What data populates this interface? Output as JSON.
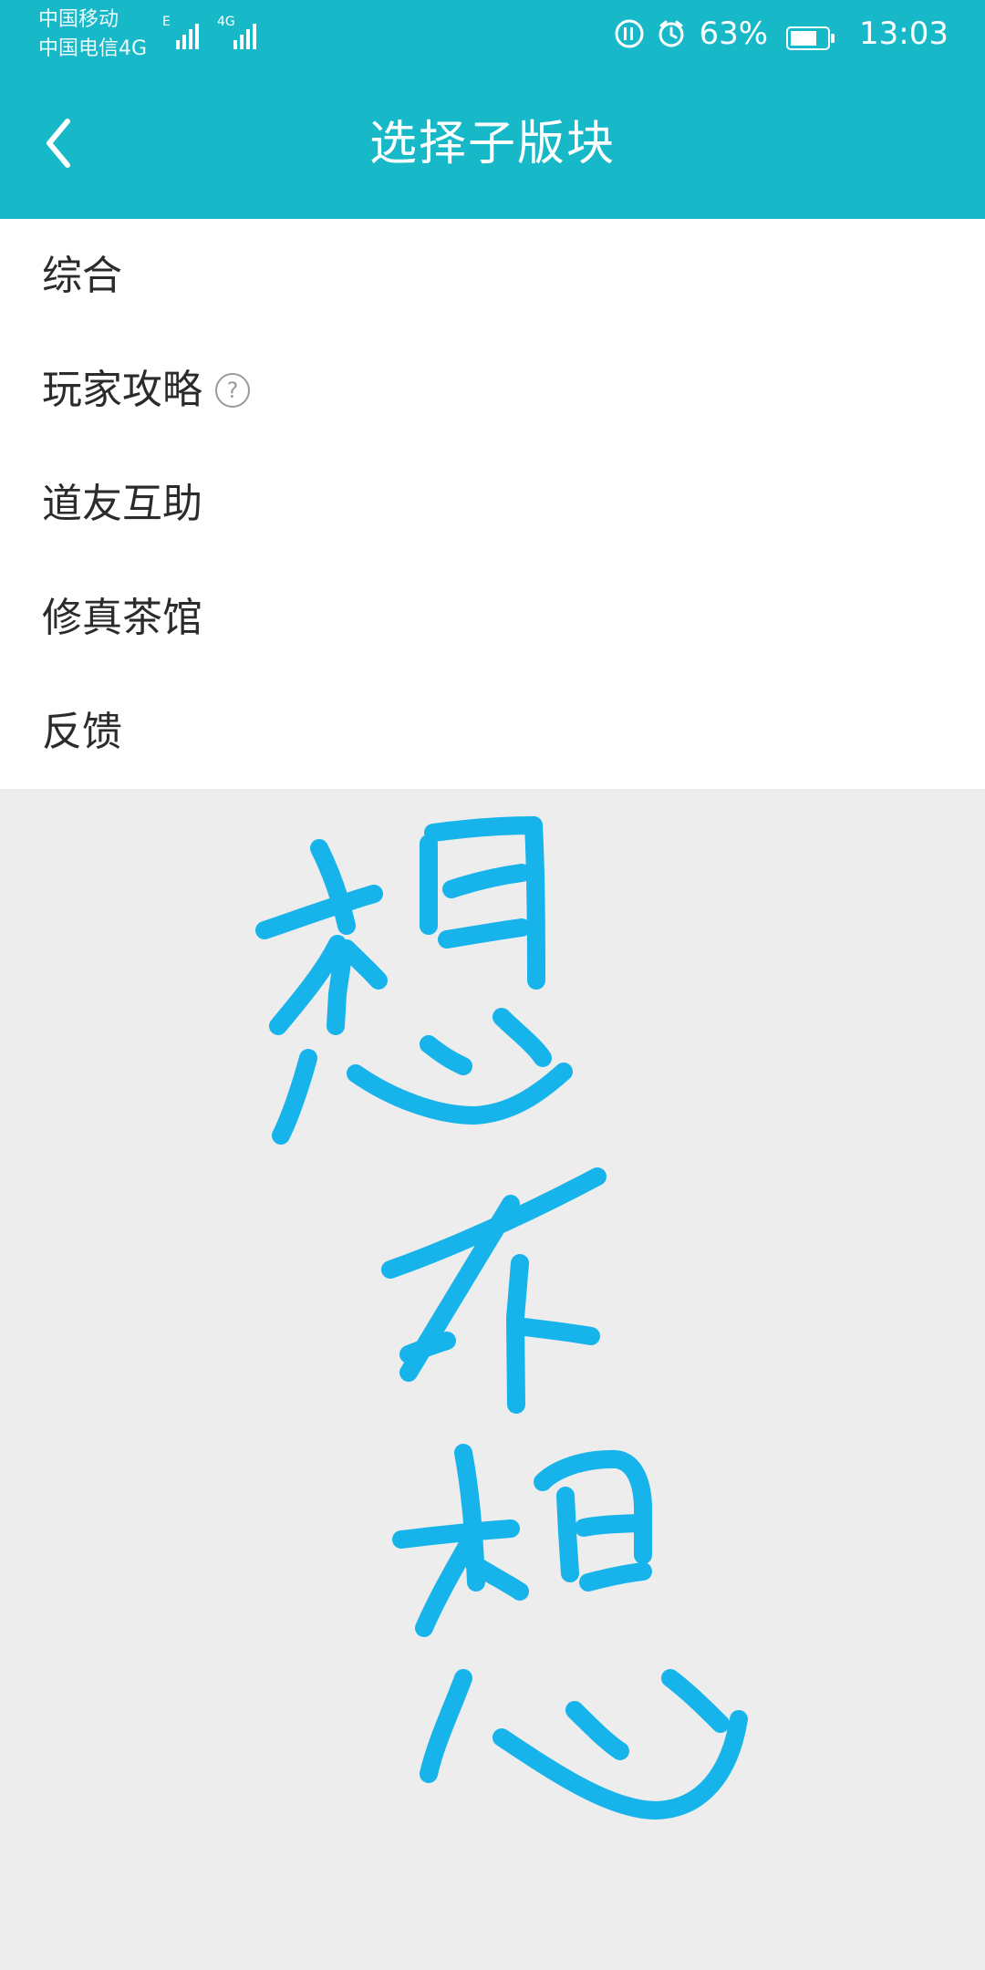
{
  "status_bar": {
    "carrier_1": "中国移动",
    "carrier_2": "中国电信4G",
    "network_1": "E",
    "network_2": "4G",
    "battery": "63%",
    "time": "13:03",
    "icons": [
      "volte-icon",
      "alarm-icon",
      "battery-icon"
    ]
  },
  "app_bar": {
    "title": "选择子版块",
    "back_icon": "chevron-left-icon"
  },
  "list": {
    "items": [
      {
        "label": "综合"
      },
      {
        "label": "玩家攻略",
        "help_icon": "help-circle-icon"
      },
      {
        "label": "道友互助"
      },
      {
        "label": "修真茶馆"
      },
      {
        "label": "反馈"
      }
    ]
  },
  "colors": {
    "header_bg": "#17b9c9",
    "background": "#ededed",
    "list_bg": "#ffffff",
    "text": "#2b2b2b",
    "handwriting": "#16b4ea"
  },
  "handwriting": {
    "text": "想不想"
  }
}
